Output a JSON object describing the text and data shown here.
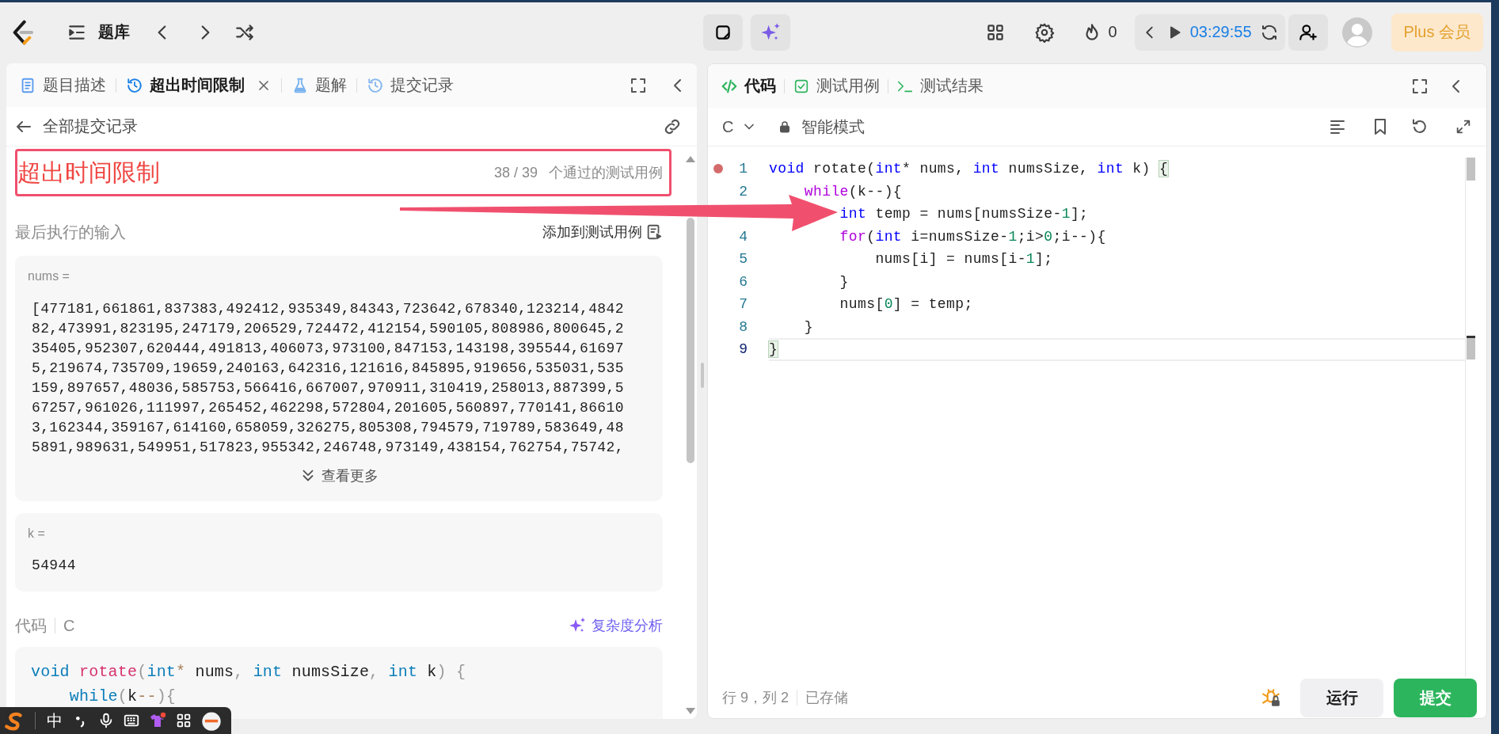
{
  "top_bar": {
    "problem_list": "题库",
    "streak_count": "0",
    "timer": "03:29:55",
    "plus_button": "Plus 会员"
  },
  "left_panel": {
    "tabs": [
      {
        "label": "题目描述",
        "selected": false
      },
      {
        "label": "超出时间限制",
        "selected": true,
        "closable": true
      },
      {
        "label": "题解",
        "selected": false
      },
      {
        "label": "提交记录",
        "selected": false
      }
    ],
    "back_link": "全部提交记录",
    "result": {
      "status": "超出时间限制",
      "passed": "38 / 39",
      "passed_label": "个通过的测试用例"
    },
    "last_input_label": "最后执行的输入",
    "add_to_testcases": "添加到测试用例",
    "inputs": [
      {
        "name": "nums =",
        "value": "[477181,661861,837383,492412,935349,84343,723642,678340,123214,484282,473991,823195,247179,206529,724472,412154,590105,808986,800645,235405,952307,620444,491813,406073,973100,847153,143198,395544,616975,219674,735709,19659,240163,642316,121616,845895,919656,535031,535159,897657,48036,585753,566416,667007,970911,310419,258013,887399,567257,961026,111997,265452,462298,572804,201605,560897,770141,866103,162344,359167,614160,658059,326275,805308,794579,719789,583649,485891,989631,549951,517823,955342,246748,973149,438154,762754,75742,",
        "expand_label": "查看更多"
      },
      {
        "name": "k =",
        "value": "54944"
      }
    ],
    "code_label": "代码",
    "code_language": "C",
    "analysis_button": "复杂度分析",
    "code_lines": [
      [
        {
          "text": "void",
          "kind": "keyword"
        },
        {
          "text": " rotate",
          "kind": "function"
        },
        {
          "text": "(",
          "kind": "punct"
        },
        {
          "text": "int",
          "kind": "keyword"
        },
        {
          "text": "*",
          "kind": "operator"
        },
        {
          "text": " nums",
          "kind": "plain"
        },
        {
          "text": ", ",
          "kind": "punct"
        },
        {
          "text": "int",
          "kind": "keyword"
        },
        {
          "text": " numsSize",
          "kind": "plain"
        },
        {
          "text": ", ",
          "kind": "punct"
        },
        {
          "text": "int",
          "kind": "keyword"
        },
        {
          "text": " k",
          "kind": "plain"
        },
        {
          "text": ")",
          "kind": "punct"
        },
        {
          "text": " {",
          "kind": "punct"
        }
      ],
      [
        {
          "text": "    while",
          "kind": "keyword"
        },
        {
          "text": "(",
          "kind": "punct"
        },
        {
          "text": "k",
          "kind": "plain"
        },
        {
          "text": "--",
          "kind": "operator"
        },
        {
          "text": "){",
          "kind": "punct"
        }
      ]
    ]
  },
  "right_panel": {
    "tabs": [
      {
        "label": "代码",
        "selected": true
      },
      {
        "label": "测试用例",
        "selected": false
      },
      {
        "label": "测试结果",
        "selected": false
      }
    ],
    "language": "C",
    "mode": "智能模式",
    "editor": {
      "lines": [
        {
          "number": "1",
          "breakpoint": true,
          "current": false,
          "tokens": [
            {
              "text": "void",
              "kind": "keyword"
            },
            {
              "text": " rotate",
              "kind": "function"
            },
            {
              "text": "(",
              "kind": "plain"
            },
            {
              "text": "int",
              "kind": "keyword"
            },
            {
              "text": "* nums, ",
              "kind": "plain"
            },
            {
              "text": "int",
              "kind": "keyword"
            },
            {
              "text": " numsSize, ",
              "kind": "plain"
            },
            {
              "text": "int",
              "kind": "keyword"
            },
            {
              "text": " k) ",
              "kind": "plain"
            },
            {
              "text": "{",
              "kind": "bracket_match"
            }
          ]
        },
        {
          "number": "2",
          "breakpoint": false,
          "current": false,
          "tokens": [
            {
              "text": "    while",
              "kind": "control"
            },
            {
              "text": "(k--){",
              "kind": "plain"
            }
          ]
        },
        {
          "breakpoint": false,
          "current": false,
          "tokens": [
            {
              "text": "        int",
              "kind": "keyword"
            },
            {
              "text": " temp = nums[numsSize-",
              "kind": "plain"
            },
            {
              "text": "1",
              "kind": "number"
            },
            {
              "text": "];",
              "kind": "plain"
            }
          ]
        },
        {
          "number": "4",
          "breakpoint": false,
          "current": false,
          "tokens": [
            {
              "text": "        for",
              "kind": "control"
            },
            {
              "text": "(",
              "kind": "plain"
            },
            {
              "text": "int",
              "kind": "keyword"
            },
            {
              "text": " i=numsSize-",
              "kind": "plain"
            },
            {
              "text": "1",
              "kind": "number"
            },
            {
              "text": ";i>",
              "kind": "plain"
            },
            {
              "text": "0",
              "kind": "number"
            },
            {
              "text": ";i--){",
              "kind": "plain"
            }
          ]
        },
        {
          "number": "5",
          "breakpoint": false,
          "current": false,
          "tokens": [
            {
              "text": "            nums[i] = nums[i-",
              "kind": "plain"
            },
            {
              "text": "1",
              "kind": "number"
            },
            {
              "text": "];",
              "kind": "plain"
            }
          ]
        },
        {
          "number": "6",
          "breakpoint": false,
          "current": false,
          "tokens": [
            {
              "text": "        }",
              "kind": "plain"
            }
          ]
        },
        {
          "number": "7",
          "breakpoint": false,
          "current": false,
          "tokens": [
            {
              "text": "        nums[",
              "kind": "plain"
            },
            {
              "text": "0",
              "kind": "number"
            },
            {
              "text": "] = temp;",
              "kind": "plain"
            }
          ]
        },
        {
          "number": "8",
          "breakpoint": false,
          "current": false,
          "tokens": [
            {
              "text": "    }",
              "kind": "plain"
            }
          ]
        },
        {
          "number": "9",
          "breakpoint": false,
          "current": true,
          "tokens": [
            {
              "text": "}",
              "kind": "bracket_match"
            }
          ]
        }
      ]
    },
    "cursor_position": "行 9，列 2",
    "save_status": "已存储",
    "run_button": "运行",
    "submit_button": "提交"
  },
  "ime_bar": {
    "language": "中"
  }
}
